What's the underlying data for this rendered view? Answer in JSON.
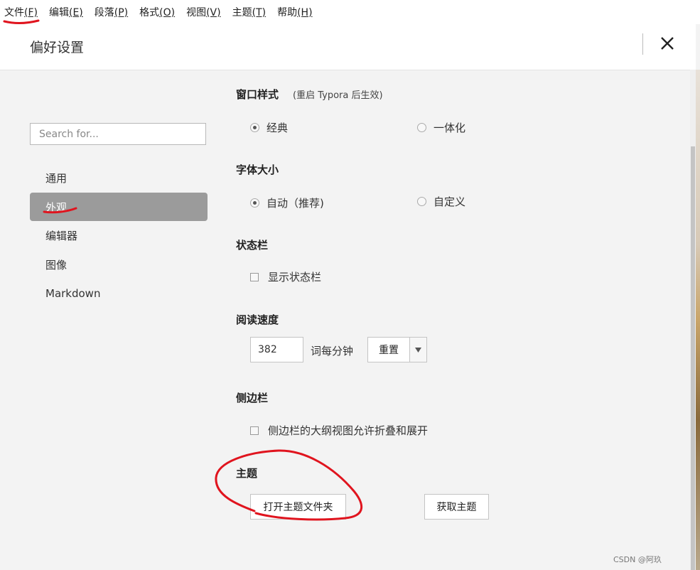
{
  "menubar": {
    "items": [
      {
        "label": "文件",
        "key": "(F)"
      },
      {
        "label": "编辑",
        "key": "(E)"
      },
      {
        "label": "段落",
        "key": "(P)"
      },
      {
        "label": "格式",
        "key": "(O)"
      },
      {
        "label": "视图",
        "key": "(V)"
      },
      {
        "label": "主题",
        "key": "(T)"
      },
      {
        "label": "帮助",
        "key": "(H)"
      }
    ]
  },
  "header": {
    "title": "偏好设置",
    "close_icon": "close-icon"
  },
  "sidebar": {
    "search_placeholder": "Search for...",
    "items": [
      {
        "label": "通用",
        "active": false
      },
      {
        "label": "外观",
        "active": true
      },
      {
        "label": "编辑器",
        "active": false
      },
      {
        "label": "图像",
        "active": false
      },
      {
        "label": "Markdown",
        "active": false
      }
    ]
  },
  "sections": {
    "window_style": {
      "title": "窗口样式",
      "note": "(重启 Typora 后生效)",
      "options": [
        {
          "label": "经典",
          "checked": true
        },
        {
          "label": "一体化",
          "checked": false
        }
      ]
    },
    "font_size": {
      "title": "字体大小",
      "options": [
        {
          "label": "自动（推荐)",
          "checked": true
        },
        {
          "label": "自定义",
          "checked": false
        }
      ]
    },
    "status_bar": {
      "title": "状态栏",
      "checkbox_label": "显示状态栏",
      "checked": false
    },
    "reading_speed": {
      "title": "阅读速度",
      "value": "382",
      "unit": "词每分钟",
      "reset_label": "重置",
      "dropdown_icon": "triangle-down-icon"
    },
    "sidebar_section": {
      "title": "侧边栏",
      "checkbox_label": "侧边栏的大纲视图允许折叠和展开",
      "checked": false
    },
    "theme": {
      "title": "主题",
      "open_folder_label": "打开主题文件夹",
      "get_themes_label": "获取主题"
    }
  },
  "annotation_color": "#e0141e",
  "watermark": "CSDN @阿玖"
}
